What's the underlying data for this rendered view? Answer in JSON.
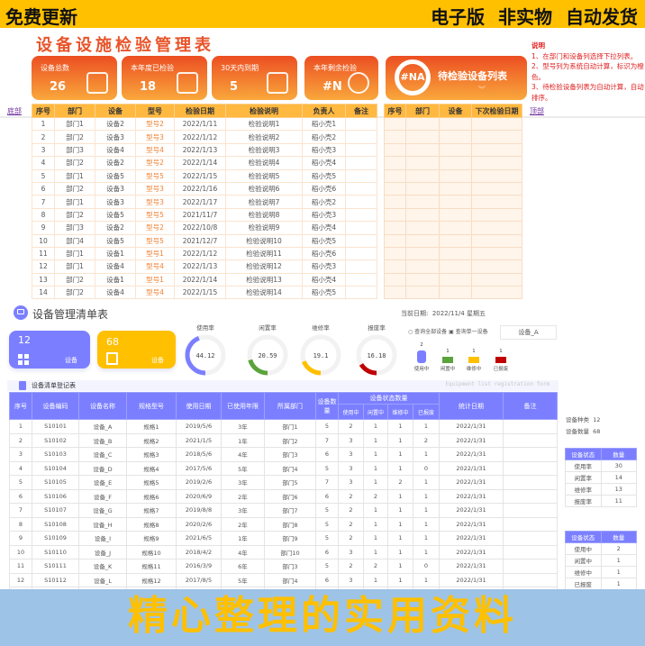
{
  "promo": {
    "left": "免费更新",
    "right": "电子版 非实物 自动发货",
    "bottom": "精心整理的实用资料"
  },
  "sheet1": {
    "title": "设备设施检验管理表",
    "cards": [
      {
        "label": "设备总数",
        "value": "26",
        "icon": "router-icon"
      },
      {
        "label": "本年度已检验",
        "value": "18",
        "icon": "presentation-chart-icon"
      },
      {
        "label": "30天内到期",
        "value": "5",
        "icon": "calendar-clock-icon"
      },
      {
        "label": "本年剩余检验",
        "value": "#N",
        "icon": "target-icon"
      }
    ],
    "pending": {
      "value": "#NA",
      "label": "待检验设备列表"
    },
    "notes": {
      "title": "说明",
      "items": [
        "1、在部门和设备列选择下拉列表。",
        "2、型号列为系统自动计算，标识为橙色。",
        "3、待检验设备列表为自动计算，自动排序。"
      ]
    },
    "link_bottom": "底部",
    "link_top": "顶部",
    "columns": [
      "序号",
      "部门",
      "设备",
      "型号",
      "检验日期",
      "检验说明",
      "负责人",
      "备注"
    ],
    "rows": [
      [
        "1",
        "部门1",
        "设备2",
        "型号2",
        "2022/1/11",
        "检验说明1",
        "稻小壳1",
        ""
      ],
      [
        "2",
        "部门2",
        "设备3",
        "型号3",
        "2022/1/12",
        "检验说明2",
        "稻小壳2",
        ""
      ],
      [
        "3",
        "部门3",
        "设备4",
        "型号4",
        "2022/1/13",
        "检验说明3",
        "稻小壳3",
        ""
      ],
      [
        "4",
        "部门2",
        "设备2",
        "型号2",
        "2022/1/14",
        "检验说明4",
        "稻小壳4",
        ""
      ],
      [
        "5",
        "部门1",
        "设备5",
        "型号5",
        "2022/1/15",
        "检验说明5",
        "稻小壳5",
        ""
      ],
      [
        "6",
        "部门2",
        "设备3",
        "型号3",
        "2022/1/16",
        "检验说明6",
        "稻小壳6",
        ""
      ],
      [
        "7",
        "部门1",
        "设备3",
        "型号3",
        "2022/1/17",
        "检验说明7",
        "稻小壳2",
        ""
      ],
      [
        "8",
        "部门2",
        "设备5",
        "型号5",
        "2021/11/7",
        "检验说明8",
        "稻小壳3",
        ""
      ],
      [
        "9",
        "部门3",
        "设备2",
        "型号2",
        "2022/10/8",
        "检验说明9",
        "稻小壳4",
        ""
      ],
      [
        "10",
        "部门4",
        "设备5",
        "型号5",
        "2021/12/7",
        "检验说明10",
        "稻小壳5",
        ""
      ],
      [
        "11",
        "部门1",
        "设备1",
        "型号1",
        "2022/1/12",
        "检验说明11",
        "稻小壳6",
        ""
      ],
      [
        "12",
        "部门1",
        "设备4",
        "型号4",
        "2022/1/13",
        "检验说明12",
        "稻小壳3",
        ""
      ],
      [
        "13",
        "部门2",
        "设备1",
        "型号1",
        "2022/1/14",
        "检验说明13",
        "稻小壳4",
        ""
      ],
      [
        "14",
        "部门2",
        "设备4",
        "型号4",
        "2022/1/15",
        "检验说明14",
        "稻小壳5",
        ""
      ]
    ],
    "pending_columns": [
      "序号",
      "部门",
      "设备",
      "下次检验日期"
    ]
  },
  "sheet2": {
    "title": "设备管理清单表",
    "date_label": "当前日期:",
    "date": "2022/11/4",
    "weekday": "星期五",
    "kpis": [
      {
        "value": "12",
        "label": "设备",
        "color": "#7B7FFF",
        "icon": "grid-icon"
      },
      {
        "value": "68",
        "label": "设备",
        "color": "#FFC000",
        "icon": "notepad-icon"
      }
    ],
    "rates": [
      {
        "label": "使用率",
        "value": 44.12,
        "color": "#7B7FFF"
      },
      {
        "label": "闲置率",
        "value": 20.59,
        "color": "#5BA33B"
      },
      {
        "label": "维修率",
        "value": 19.1,
        "color": "#FFC000"
      },
      {
        "label": "报废率",
        "value": 16.18,
        "color": "#C00000"
      }
    ],
    "query": {
      "all": "查询全部设备",
      "single": "查询单一设备",
      "selected": "设备_A"
    },
    "status_bars": [
      {
        "label": "使用中",
        "value": 2,
        "color": "#7B7FFF"
      },
      {
        "label": "闲置中",
        "value": 1,
        "color": "#5BA33B"
      },
      {
        "label": "维修中",
        "value": 1,
        "color": "#FFC000"
      },
      {
        "label": "已报废",
        "value": 1,
        "color": "#C00000"
      }
    ],
    "register_title": "设备清单登记表",
    "register_en": "Equipment list registration form",
    "columns": [
      "序号",
      "设备编码",
      "设备名称",
      "规格型号",
      "使用日期",
      "已使用年限",
      "所属部门",
      "设备数量",
      "设备状态数量",
      "统计日期",
      "备注"
    ],
    "status_columns": [
      "使用中",
      "闲置中",
      "维修中",
      "已报废"
    ],
    "rows": [
      [
        "1",
        "S10101",
        "设备_A",
        "规格1",
        "2019/5/6",
        "3年",
        "部门1",
        "5",
        "2",
        "1",
        "1",
        "1",
        "2022/1/31",
        ""
      ],
      [
        "2",
        "S10102",
        "设备_B",
        "规格2",
        "2021/1/5",
        "1年",
        "部门2",
        "7",
        "3",
        "1",
        "1",
        "2",
        "2022/1/31",
        ""
      ],
      [
        "3",
        "S10103",
        "设备_C",
        "规格3",
        "2018/5/6",
        "4年",
        "部门3",
        "6",
        "3",
        "1",
        "1",
        "1",
        "2022/1/31",
        ""
      ],
      [
        "4",
        "S10104",
        "设备_D",
        "规格4",
        "2017/5/6",
        "5年",
        "部门4",
        "5",
        "3",
        "1",
        "1",
        "0",
        "2022/1/31",
        ""
      ],
      [
        "5",
        "S10105",
        "设备_E",
        "规格5",
        "2019/2/6",
        "3年",
        "部门5",
        "7",
        "3",
        "1",
        "2",
        "1",
        "2022/1/31",
        ""
      ],
      [
        "6",
        "S10106",
        "设备_F",
        "规格6",
        "2020/6/9",
        "2年",
        "部门6",
        "6",
        "2",
        "2",
        "1",
        "1",
        "2022/1/31",
        ""
      ],
      [
        "7",
        "S10107",
        "设备_G",
        "规格7",
        "2019/8/8",
        "3年",
        "部门7",
        "5",
        "2",
        "1",
        "1",
        "1",
        "2022/1/31",
        ""
      ],
      [
        "8",
        "S10108",
        "设备_H",
        "规格8",
        "2020/2/6",
        "2年",
        "部门8",
        "5",
        "2",
        "1",
        "1",
        "1",
        "2022/1/31",
        ""
      ],
      [
        "9",
        "S10109",
        "设备_I",
        "规格9",
        "2021/6/5",
        "1年",
        "部门9",
        "5",
        "2",
        "1",
        "1",
        "1",
        "2022/1/31",
        ""
      ],
      [
        "10",
        "S10110",
        "设备_J",
        "规格10",
        "2018/4/2",
        "4年",
        "部门10",
        "6",
        "3",
        "1",
        "1",
        "1",
        "2022/1/31",
        ""
      ],
      [
        "11",
        "S10111",
        "设备_K",
        "规格11",
        "2016/3/9",
        "6年",
        "部门3",
        "5",
        "2",
        "2",
        "1",
        "0",
        "2022/1/31",
        ""
      ],
      [
        "12",
        "S10112",
        "设备_L",
        "规格12",
        "2017/8/5",
        "5年",
        "部门4",
        "6",
        "3",
        "1",
        "1",
        "1",
        "2022/1/31",
        ""
      ]
    ],
    "summary": {
      "kinds_label": "设备种类",
      "kinds": "12",
      "count_label": "设备数量",
      "count": "68"
    },
    "rate_table": {
      "headers": [
        "设备状态",
        "数量"
      ],
      "rows": [
        [
          "使用率",
          "30"
        ],
        [
          "闲置率",
          "14"
        ],
        [
          "维修率",
          "13"
        ],
        [
          "报废率",
          "11"
        ]
      ]
    },
    "status_table": {
      "headers": [
        "设备状态",
        "数量"
      ],
      "rows": [
        [
          "使用中",
          "2"
        ],
        [
          "闲置中",
          "1"
        ],
        [
          "维修中",
          "1"
        ],
        [
          "已报废",
          "1"
        ]
      ]
    }
  }
}
